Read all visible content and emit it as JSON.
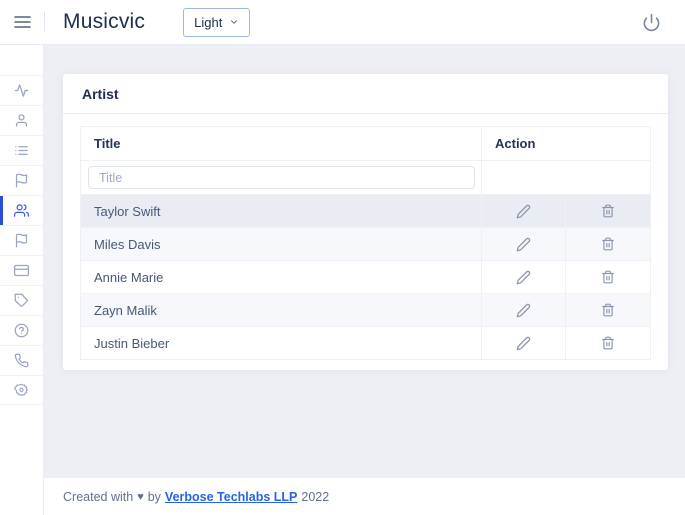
{
  "topbar": {
    "title": "Musicvic",
    "theme_select_value": "Light"
  },
  "sidebar": {
    "items": [
      {
        "icon": "activity-icon",
        "active": false
      },
      {
        "icon": "user-icon",
        "active": false
      },
      {
        "icon": "list-icon",
        "active": false
      },
      {
        "icon": "flag-icon",
        "active": false
      },
      {
        "icon": "users-icon",
        "active": true
      },
      {
        "icon": "flag2-icon",
        "active": false
      },
      {
        "icon": "credit-card-icon",
        "active": false
      },
      {
        "icon": "tag-icon",
        "active": false
      },
      {
        "icon": "help-circle-icon",
        "active": false
      },
      {
        "icon": "phone-icon",
        "active": false
      },
      {
        "icon": "award-icon",
        "active": false
      }
    ]
  },
  "card": {
    "title": "Artist",
    "table": {
      "headers": {
        "title": "Title",
        "action": "Action"
      },
      "filter_placeholder": "Title",
      "rows": [
        {
          "title": "Taylor Swift"
        },
        {
          "title": "Miles Davis"
        },
        {
          "title": "Annie Marie"
        },
        {
          "title": "Zayn Malik"
        },
        {
          "title": "Justin Bieber"
        }
      ]
    }
  },
  "footer": {
    "created_prefix": "Created with",
    "heart": "♥",
    "by_text": "by",
    "company_link": "Verbose Techlabs LLP",
    "year": "2022"
  },
  "colors": {
    "accent_blue": "#3b5ce4",
    "active_bar_blue": "#2f4ed8",
    "link_blue": "#2563eb",
    "content_bg": "#edeff5",
    "row_hover_bg": "#e9ecf3",
    "row_stripe_bg": "#f7f8fb"
  }
}
